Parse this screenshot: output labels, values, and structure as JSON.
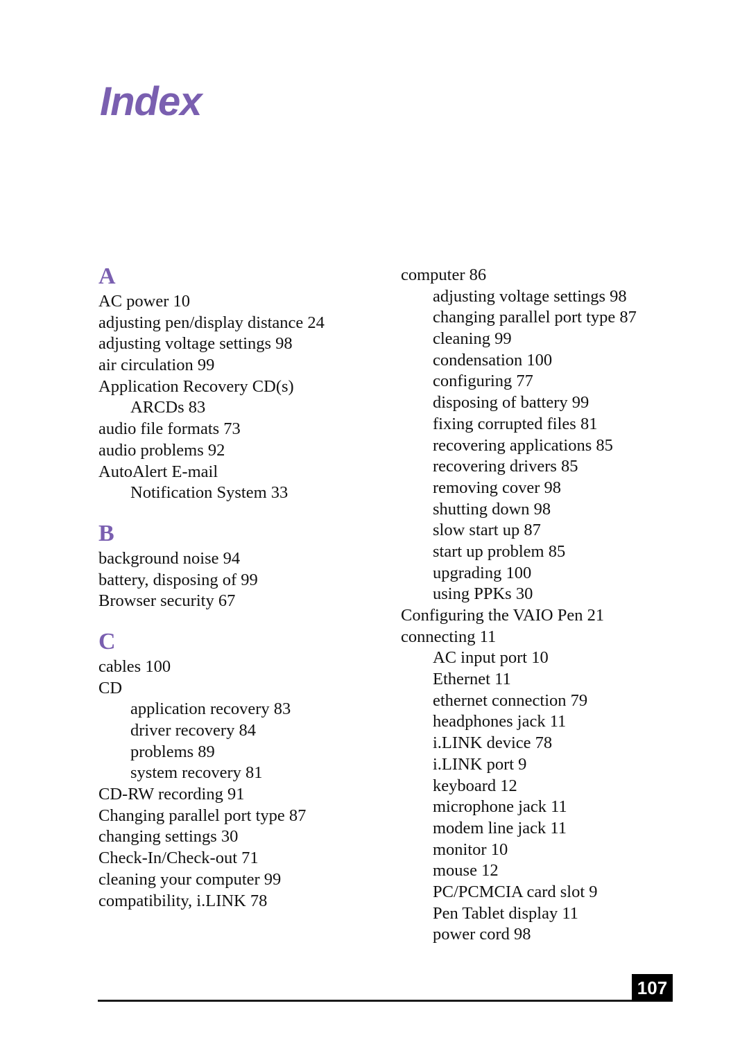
{
  "title": "Index",
  "page_number": "107",
  "left_column": [
    {
      "type": "letter",
      "text": "A"
    },
    {
      "type": "entry",
      "text": "AC power 10"
    },
    {
      "type": "entry",
      "text": "adjusting pen/display distance 24"
    },
    {
      "type": "entry",
      "text": "adjusting voltage settings 98"
    },
    {
      "type": "entry",
      "text": "air circulation 99"
    },
    {
      "type": "entry",
      "text": "Application Recovery CD(s)"
    },
    {
      "type": "sub",
      "text": "ARCDs 83"
    },
    {
      "type": "entry",
      "text": "audio file formats 73"
    },
    {
      "type": "entry",
      "text": "audio problems 92"
    },
    {
      "type": "entry",
      "text": "AutoAlert E-mail"
    },
    {
      "type": "sub",
      "text": "Notification System 33"
    },
    {
      "type": "gap"
    },
    {
      "type": "letter",
      "text": "B"
    },
    {
      "type": "entry",
      "text": "background noise 94"
    },
    {
      "type": "entry",
      "text": "battery, disposing of 99"
    },
    {
      "type": "entry",
      "text": "Browser security 67"
    },
    {
      "type": "gap"
    },
    {
      "type": "letter",
      "text": "C"
    },
    {
      "type": "entry",
      "text": "cables 100"
    },
    {
      "type": "entry",
      "text": "CD"
    },
    {
      "type": "sub",
      "text": "application recovery 83"
    },
    {
      "type": "sub",
      "text": "driver recovery 84"
    },
    {
      "type": "sub",
      "text": "problems 89"
    },
    {
      "type": "sub",
      "text": "system recovery 81"
    },
    {
      "type": "entry",
      "text": "CD-RW recording 91"
    },
    {
      "type": "entry",
      "text": "Changing parallel port type 87"
    },
    {
      "type": "entry",
      "text": "changing settings 30"
    },
    {
      "type": "entry",
      "text": "Check-In/Check-out 71"
    },
    {
      "type": "entry",
      "text": "cleaning your computer 99"
    },
    {
      "type": "entry",
      "text": "compatibility, i.LINK 78"
    }
  ],
  "right_column": [
    {
      "type": "entry",
      "text": "computer 86"
    },
    {
      "type": "sub",
      "text": "adjusting voltage settings 98"
    },
    {
      "type": "sub",
      "text": "changing parallel port type 87"
    },
    {
      "type": "sub",
      "text": "cleaning 99"
    },
    {
      "type": "sub",
      "text": "condensation 100"
    },
    {
      "type": "sub",
      "text": "configuring 77"
    },
    {
      "type": "sub",
      "text": "disposing of battery 99"
    },
    {
      "type": "sub",
      "text": "fixing corrupted files 81"
    },
    {
      "type": "sub",
      "text": "recovering applications 85"
    },
    {
      "type": "sub",
      "text": "recovering drivers 85"
    },
    {
      "type": "sub",
      "text": "removing cover 98"
    },
    {
      "type": "sub",
      "text": "shutting down 98"
    },
    {
      "type": "sub",
      "text": "slow start up 87"
    },
    {
      "type": "sub",
      "text": "start up problem 85"
    },
    {
      "type": "sub",
      "text": "upgrading 100"
    },
    {
      "type": "sub",
      "text": "using PPKs 30"
    },
    {
      "type": "entry",
      "text": "Configuring the VAIO Pen 21"
    },
    {
      "type": "entry",
      "text": "connecting 11"
    },
    {
      "type": "sub",
      "text": "AC input port 10"
    },
    {
      "type": "sub",
      "text": "Ethernet 11"
    },
    {
      "type": "sub",
      "text": "ethernet connection 79"
    },
    {
      "type": "sub",
      "text": "headphones jack 11"
    },
    {
      "type": "sub",
      "text": "i.LINK device 78"
    },
    {
      "type": "sub",
      "text": "i.LINK port 9"
    },
    {
      "type": "sub",
      "text": "keyboard 12"
    },
    {
      "type": "sub",
      "text": "microphone jack 11"
    },
    {
      "type": "sub",
      "text": "modem line jack 11"
    },
    {
      "type": "sub",
      "text": "monitor 10"
    },
    {
      "type": "sub",
      "text": "mouse 12"
    },
    {
      "type": "sub",
      "text": "PC/PCMCIA card slot 9"
    },
    {
      "type": "sub",
      "text": "Pen Tablet display 11"
    },
    {
      "type": "sub",
      "text": "power cord 98"
    }
  ]
}
